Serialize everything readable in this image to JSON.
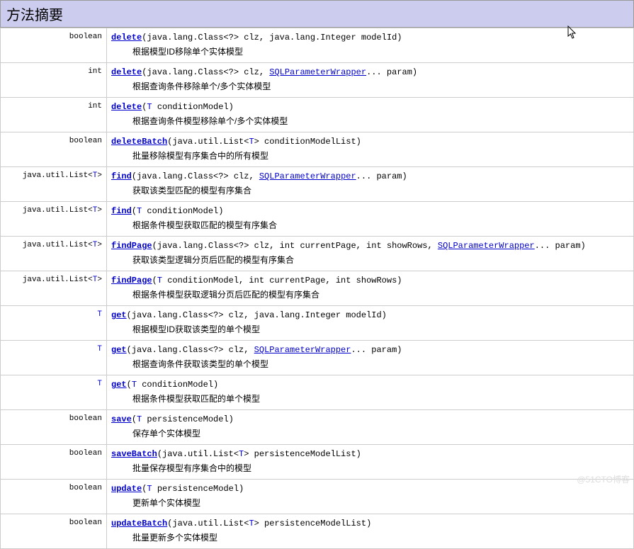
{
  "header": "方法摘要",
  "watermark": "@51CTO博客",
  "methods": [
    {
      "return": "boolean",
      "name": "delete",
      "sig_parts": [
        {
          "t": "plain",
          "v": "(java.lang.Class<?> clz, java.lang.Integer modelId)"
        }
      ],
      "desc": "根据模型ID移除单个实体模型"
    },
    {
      "return": "int",
      "name": "delete",
      "sig_parts": [
        {
          "t": "plain",
          "v": "(java.lang.Class<?> clz, "
        },
        {
          "t": "link",
          "v": "SQLParameterWrapper"
        },
        {
          "t": "plain",
          "v": "... param)"
        }
      ],
      "desc": "根据查询条件移除单个/多个实体模型"
    },
    {
      "return": "int",
      "name": "delete",
      "sig_parts": [
        {
          "t": "plain",
          "v": "("
        },
        {
          "t": "tparam",
          "v": "T"
        },
        {
          "t": "plain",
          "v": " conditionModel)"
        }
      ],
      "desc": "根据查询条件模型移除单个/多个实体模型"
    },
    {
      "return": "boolean",
      "name": "deleteBatch",
      "sig_parts": [
        {
          "t": "plain",
          "v": "(java.util.List<"
        },
        {
          "t": "tparam",
          "v": "T"
        },
        {
          "t": "plain",
          "v": "> conditionModelList)"
        }
      ],
      "desc": "批量移除模型有序集合中的所有模型"
    },
    {
      "return": "java.util.List<T>",
      "name": "find",
      "sig_parts": [
        {
          "t": "plain",
          "v": "(java.lang.Class<?> clz, "
        },
        {
          "t": "link",
          "v": "SQLParameterWrapper"
        },
        {
          "t": "plain",
          "v": "... param)"
        }
      ],
      "desc": "获取该类型匹配的模型有序集合"
    },
    {
      "return": "java.util.List<T>",
      "name": "find",
      "sig_parts": [
        {
          "t": "plain",
          "v": "("
        },
        {
          "t": "tparam",
          "v": "T"
        },
        {
          "t": "plain",
          "v": " conditionModel)"
        }
      ],
      "desc": "根据条件模型获取匹配的模型有序集合"
    },
    {
      "return": "java.util.List<T>",
      "name": "findPage",
      "sig_parts": [
        {
          "t": "plain",
          "v": "(java.lang.Class<?> clz, int currentPage, int showRows, "
        },
        {
          "t": "link",
          "v": "SQLParameterWrapper"
        },
        {
          "t": "plain",
          "v": "... param)"
        }
      ],
      "desc": "获取该类型逻辑分页后匹配的模型有序集合"
    },
    {
      "return": "java.util.List<T>",
      "name": "findPage",
      "sig_parts": [
        {
          "t": "plain",
          "v": "("
        },
        {
          "t": "tparam",
          "v": "T"
        },
        {
          "t": "plain",
          "v": " conditionModel, int currentPage, int showRows)"
        }
      ],
      "desc": "根据条件模型获取逻辑分页后匹配的模型有序集合"
    },
    {
      "return": "T",
      "name": "get",
      "sig_parts": [
        {
          "t": "plain",
          "v": "(java.lang.Class<?> clz, java.lang.Integer modelId)"
        }
      ],
      "desc": "根据模型ID获取该类型的单个模型"
    },
    {
      "return": "T",
      "name": "get",
      "sig_parts": [
        {
          "t": "plain",
          "v": "(java.lang.Class<?> clz, "
        },
        {
          "t": "link",
          "v": "SQLParameterWrapper"
        },
        {
          "t": "plain",
          "v": "... param)"
        }
      ],
      "desc": "根据查询条件获取该类型的单个模型"
    },
    {
      "return": "T",
      "name": "get",
      "sig_parts": [
        {
          "t": "plain",
          "v": "("
        },
        {
          "t": "tparam",
          "v": "T"
        },
        {
          "t": "plain",
          "v": " conditionModel)"
        }
      ],
      "desc": "根据条件模型获取匹配的单个模型"
    },
    {
      "return": "boolean",
      "name": "save",
      "sig_parts": [
        {
          "t": "plain",
          "v": "("
        },
        {
          "t": "tparam",
          "v": "T"
        },
        {
          "t": "plain",
          "v": " persistenceModel)"
        }
      ],
      "desc": "保存单个实体模型"
    },
    {
      "return": "boolean",
      "name": "saveBatch",
      "sig_parts": [
        {
          "t": "plain",
          "v": "(java.util.List<"
        },
        {
          "t": "tparam",
          "v": "T"
        },
        {
          "t": "plain",
          "v": "> persistenceModelList)"
        }
      ],
      "desc": "批量保存模型有序集合中的模型"
    },
    {
      "return": "boolean",
      "name": "update",
      "sig_parts": [
        {
          "t": "plain",
          "v": "("
        },
        {
          "t": "tparam",
          "v": "T"
        },
        {
          "t": "plain",
          "v": " persistenceModel)"
        }
      ],
      "desc": "更新单个实体模型"
    },
    {
      "return": "boolean",
      "name": "updateBatch",
      "sig_parts": [
        {
          "t": "plain",
          "v": "(java.util.List<"
        },
        {
          "t": "tparam",
          "v": "T"
        },
        {
          "t": "plain",
          "v": "> persistenceModelList)"
        }
      ],
      "desc": "批量更新多个实体模型"
    }
  ]
}
